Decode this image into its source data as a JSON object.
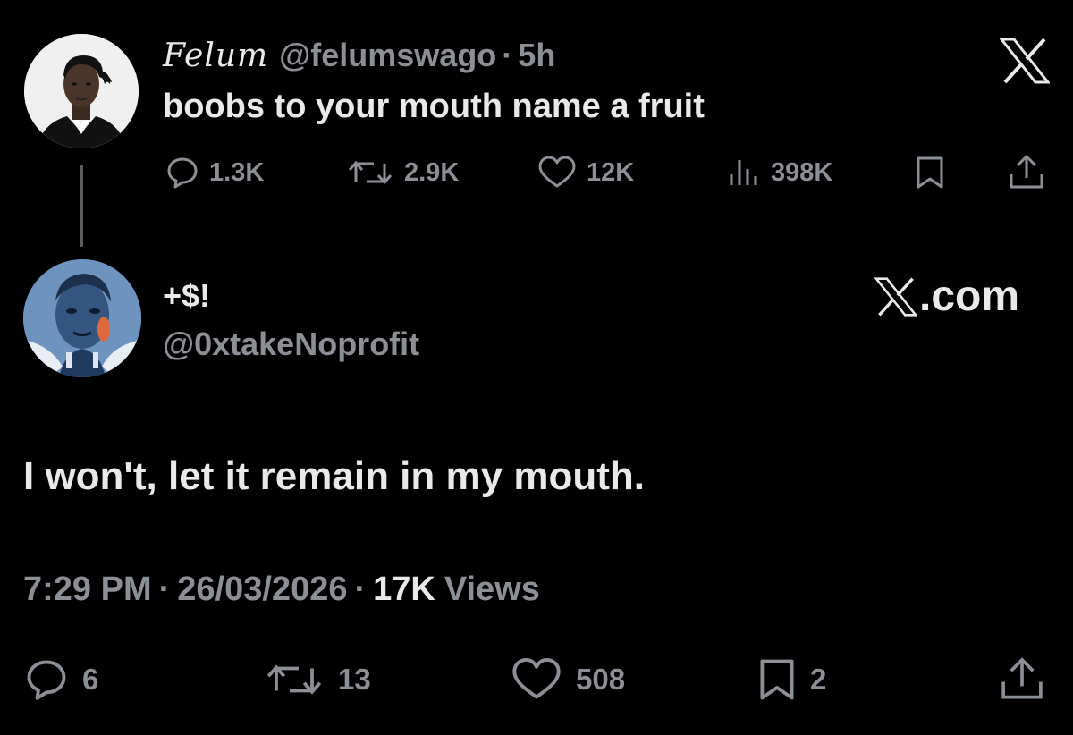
{
  "parent_tweet": {
    "display_name": "Felum",
    "handle": "@felumswago",
    "separator": "·",
    "time": "5h",
    "text": "boobs to your mouth name a fruit",
    "actions": {
      "replies": "1.3K",
      "reposts": "2.9K",
      "likes": "12K",
      "views": "398K"
    }
  },
  "reply_tweet": {
    "display_name": "+$!",
    "handle": "@0xtakeNoprofit",
    "site_label": ".com",
    "text": "I won't, let it remain in my mouth.",
    "meta": {
      "time": "7:29 PM",
      "separator": "·",
      "date": "26/03/2026",
      "views_count": "17K",
      "views_label": "Views"
    },
    "actions": {
      "replies": "6",
      "reposts": "13",
      "likes": "508",
      "bookmarks": "2"
    }
  },
  "icons": {
    "brand": "x-logo-icon",
    "reply": "comment-bubble-icon",
    "repost": "repost-arrows-icon",
    "like": "heart-icon",
    "views": "bar-chart-icon",
    "bookmark": "bookmark-icon",
    "share": "share-upload-icon"
  },
  "colors": {
    "background": "#000000",
    "primary_text": "#e7e9ea",
    "secondary_text": "#8b9096",
    "thread_line": "#5a5e63"
  }
}
